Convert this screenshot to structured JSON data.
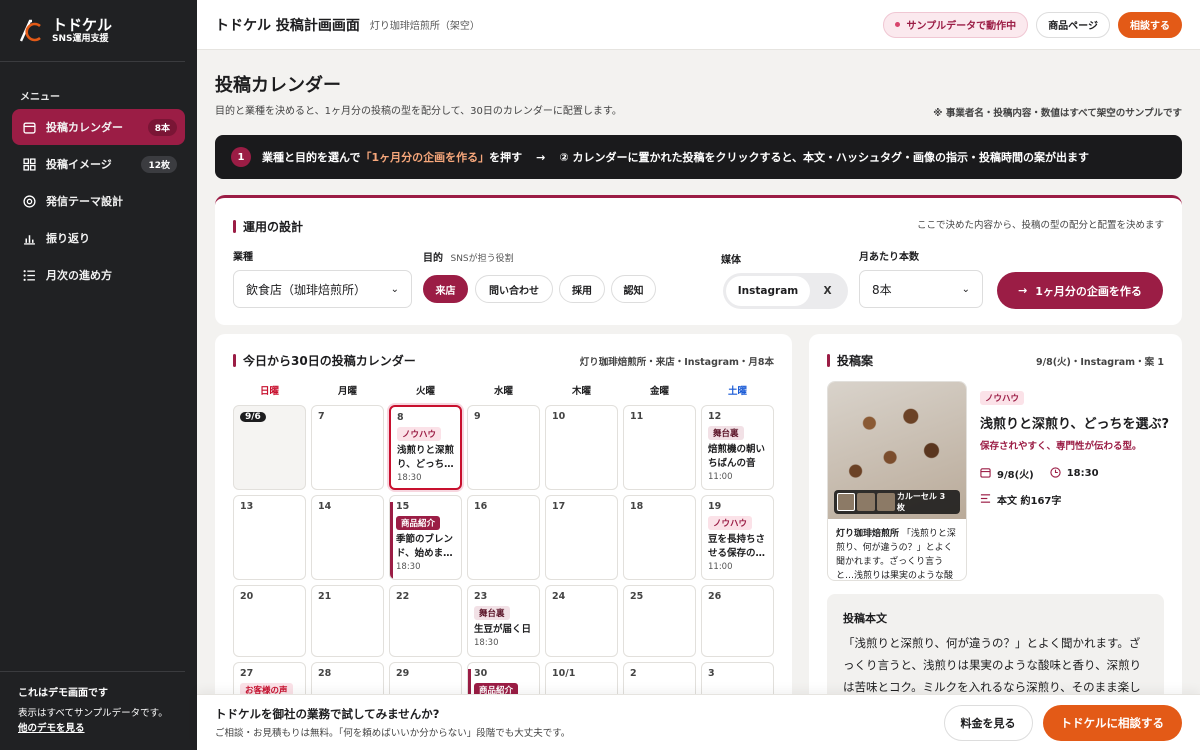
{
  "brand": {
    "name": "トドケル",
    "sub": "SNS運用支援"
  },
  "sidebar": {
    "menu_heading": "メニュー",
    "items": [
      {
        "label": "投稿カレンダー",
        "badge": "8本",
        "icon": "calendar-icon"
      },
      {
        "label": "投稿イメージ",
        "badge": "12枚",
        "icon": "grid-icon"
      },
      {
        "label": "発信テーマ設計",
        "badge": "",
        "icon": "target-icon"
      },
      {
        "label": "振り返り",
        "badge": "",
        "icon": "bar-chart-icon"
      },
      {
        "label": "月次の進め方",
        "badge": "",
        "icon": "list-icon"
      }
    ],
    "demo": {
      "title": "これはデモ画面です",
      "text": "表示はすべてサンプルデータです。",
      "link": "他のデモを見る"
    }
  },
  "topbar": {
    "title": "トドケル 投稿計画画面",
    "subtitle": "灯り珈琲焙煎所（架空）",
    "sample_label": "サンプルデータで動作中",
    "product_page": "商品ページ",
    "consult": "相談する"
  },
  "page": {
    "title": "投稿カレンダー",
    "description": "目的と業種を決めると、1ヶ月分の投稿の型を配分して、30日のカレンダーに配置します。",
    "note": "※ 事業者名・投稿内容・数値はすべて架空のサンプルです"
  },
  "stepbar": {
    "num": "1",
    "pre": "業種と目的を選んで",
    "highlight": "「1ヶ月分の企画を作る」",
    "post": "を押す",
    "arrow": "→",
    "step2": "② カレンダーに置かれた投稿をクリックすると、本文・ハッシュタグ・画像の指示・投稿時間の案が出ます"
  },
  "design": {
    "title": "運用の設計",
    "note": "ここで決めた内容から、投稿の型の配分と配置を決めます",
    "industry_label": "業種",
    "industry_value": "飲食店（珈琲焙煎所）",
    "purpose_label": "目的",
    "purpose_hint": "SNSが担う役割",
    "purposes": [
      "来店",
      "問い合わせ",
      "採用",
      "認知"
    ],
    "media_label": "媒体",
    "media_on": "Instagram",
    "media_off": "X",
    "count_label": "月あたり本数",
    "count_value": "8本",
    "make_button": "1ヶ月分の企画を作る"
  },
  "calendar": {
    "title": "今日から30日の投稿カレンダー",
    "meta": "灯り珈琲焙煎所・来店・Instagram・月8本",
    "weekdays": [
      "日曜",
      "月曜",
      "火曜",
      "水曜",
      "木曜",
      "金曜",
      "土曜"
    ],
    "cells": [
      {
        "day": "9/6",
        "today": true
      },
      {
        "day": "7"
      },
      {
        "day": "8",
        "tag": "ノウハウ",
        "tagType": "know",
        "title": "浅煎りと深煎り、どっち…",
        "time": "18:30",
        "selected": true
      },
      {
        "day": "9"
      },
      {
        "day": "10"
      },
      {
        "day": "11"
      },
      {
        "day": "12",
        "tag": "舞台裏",
        "tagType": "back",
        "title": "焙煎機の朝いちばんの音",
        "time": "11:00"
      },
      {
        "day": "13"
      },
      {
        "day": "14"
      },
      {
        "day": "15",
        "tag": "商品紹介",
        "tagType": "prod",
        "title": "季節のブレンド、始めま…",
        "time": "18:30",
        "bar": true
      },
      {
        "day": "16"
      },
      {
        "day": "17"
      },
      {
        "day": "18"
      },
      {
        "day": "19",
        "tag": "ノウハウ",
        "tagType": "know",
        "title": "豆を長持ちさせる保存の…",
        "time": "11:00"
      },
      {
        "day": "20"
      },
      {
        "day": "21"
      },
      {
        "day": "22"
      },
      {
        "day": "23",
        "tag": "舞台裏",
        "tagType": "back",
        "title": "生豆が届く日",
        "time": "18:30"
      },
      {
        "day": "24"
      },
      {
        "day": "25"
      },
      {
        "day": "26"
      },
      {
        "day": "27",
        "tag": "お客様の声",
        "tagType": "voice"
      },
      {
        "day": "28"
      },
      {
        "day": "29"
      },
      {
        "day": "30",
        "tag": "商品紹介",
        "tagType": "prod",
        "bar": true
      },
      {
        "day": "10/1"
      },
      {
        "day": "2"
      },
      {
        "day": "3"
      }
    ]
  },
  "draft": {
    "title": "投稿案",
    "meta": "9/8(火)・Instagram・案 1",
    "tag": "ノウハウ",
    "headline": "浅煎りと深煎り、どっちを選ぶ?",
    "subline": "保存されやすく、専門性が伝わる型。",
    "date": "9/8(火)",
    "time": "18:30",
    "length": "本文 約167字",
    "carousel": "カルーセル 3枚",
    "thumb_account": "灯り珈琲焙煎所",
    "thumb_caption": "「浅煎りと深煎り、何が違うの？」とよく聞かれます。ざっくり言うと…浅煎りは果実のような酸味と",
    "body_title": "投稿本文",
    "body_text": "「浅煎りと深煎り、何が違うの？」とよく聞かれます。ざっくり言うと、浅煎りは果実のような酸味と香り、深煎りは苦味とコク。ミルクを入れるなら深煎り、そのまま楽しむなら浅煎り"
  },
  "footer": {
    "title": "トドケルを御社の業務で試してみませんか?",
    "sub": "ご相談・お見積もりは無料。「何を頼めばいいか分からない」段階でも大丈夫です。",
    "price": "料金を見る",
    "consult": "トドケルに相談する"
  }
}
